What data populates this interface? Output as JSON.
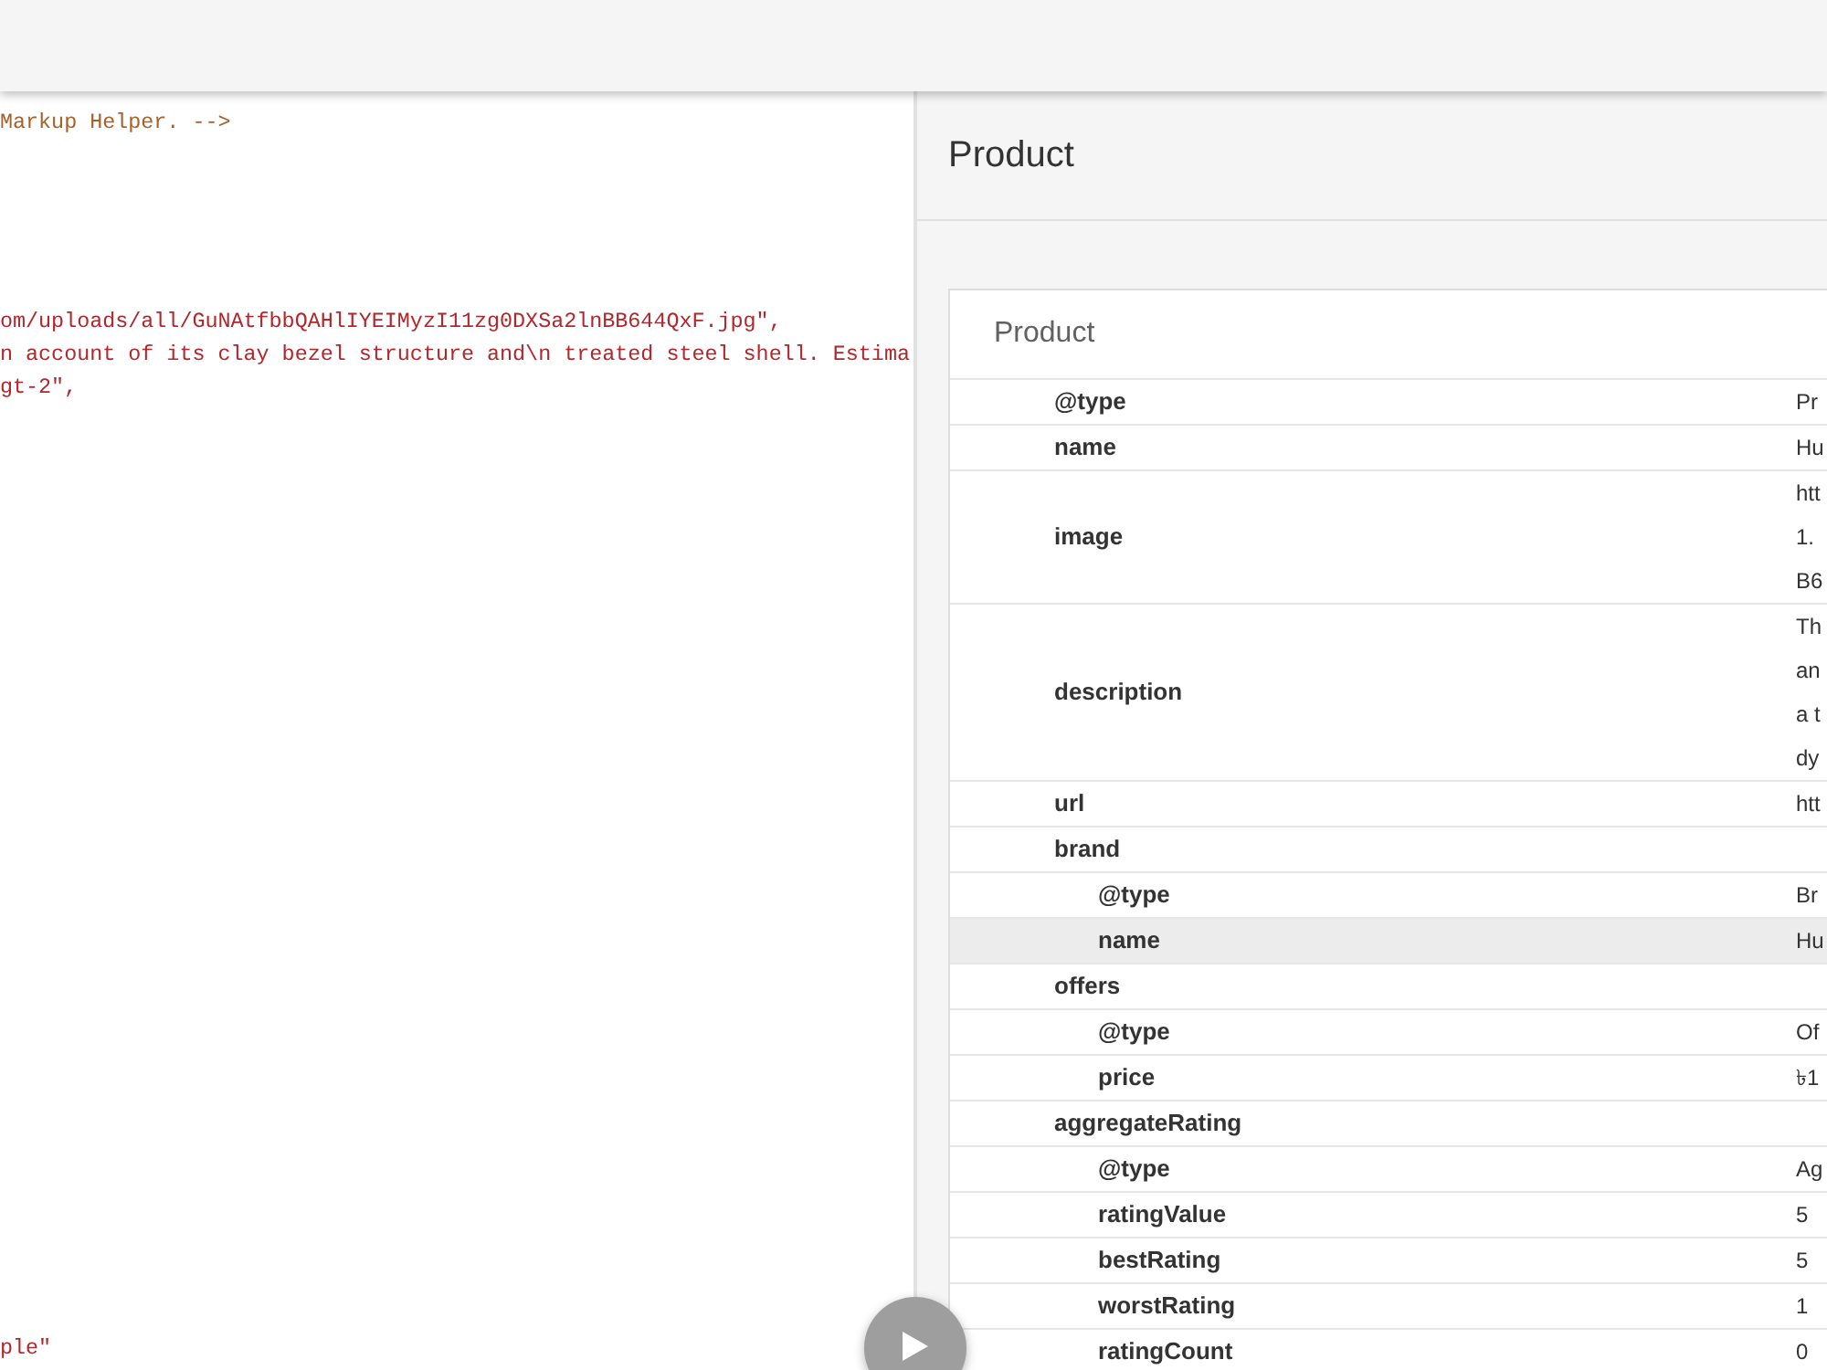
{
  "editor": {
    "blocks": [
      {
        "lines": [
          {
            "kind": "comment",
            "text": "Markup Helper. -->"
          }
        ]
      },
      {
        "lines": [
          {
            "kind": "string",
            "text": "om/uploads/all/GuNAtfbbQAHlIYEIMyzI11zg0DXSa2lnBB644QxF.jpg\","
          },
          {
            "kind": "string",
            "text": "n account of its clay bezel structure and\\n treated steel shell. Estima"
          },
          {
            "kind": "string",
            "text": "gt-2\","
          }
        ]
      },
      {
        "lines": [
          {
            "kind": "string",
            "text": "ple\""
          }
        ]
      }
    ]
  },
  "panel": {
    "title": "Product",
    "card": {
      "title": "Product",
      "rows": [
        {
          "key": "@type",
          "value": "Pr",
          "highlighted": false
        },
        {
          "key": "name",
          "value": "Hu",
          "highlighted": false
        },
        {
          "key": "image",
          "value_lines": [
            "htt",
            "1.",
            "B6"
          ],
          "highlighted": false
        },
        {
          "key": "description",
          "value_lines": [
            "Th",
            "an",
            "a t",
            "dy"
          ],
          "highlighted": false
        },
        {
          "key": "url",
          "value": "htt",
          "highlighted": false
        },
        {
          "key": "brand",
          "highlighted": false,
          "children": [
            {
              "key": "@type",
              "value": "Br",
              "highlighted": false
            },
            {
              "key": "name",
              "value": "Hu",
              "highlighted": true
            }
          ]
        },
        {
          "key": "offers",
          "highlighted": false,
          "children": [
            {
              "key": "@type",
              "value": "Of",
              "highlighted": false
            },
            {
              "key": "price",
              "value": "৳1",
              "highlighted": false
            }
          ]
        },
        {
          "key": "aggregateRating",
          "highlighted": false,
          "children": [
            {
              "key": "@type",
              "value": "Ag",
              "highlighted": false
            },
            {
              "key": "ratingValue",
              "value": "5",
              "highlighted": false
            },
            {
              "key": "bestRating",
              "value": "5",
              "highlighted": false
            },
            {
              "key": "worstRating",
              "value": "1",
              "highlighted": false
            },
            {
              "key": "ratingCount",
              "value": "0",
              "highlighted": false
            }
          ]
        }
      ]
    }
  }
}
